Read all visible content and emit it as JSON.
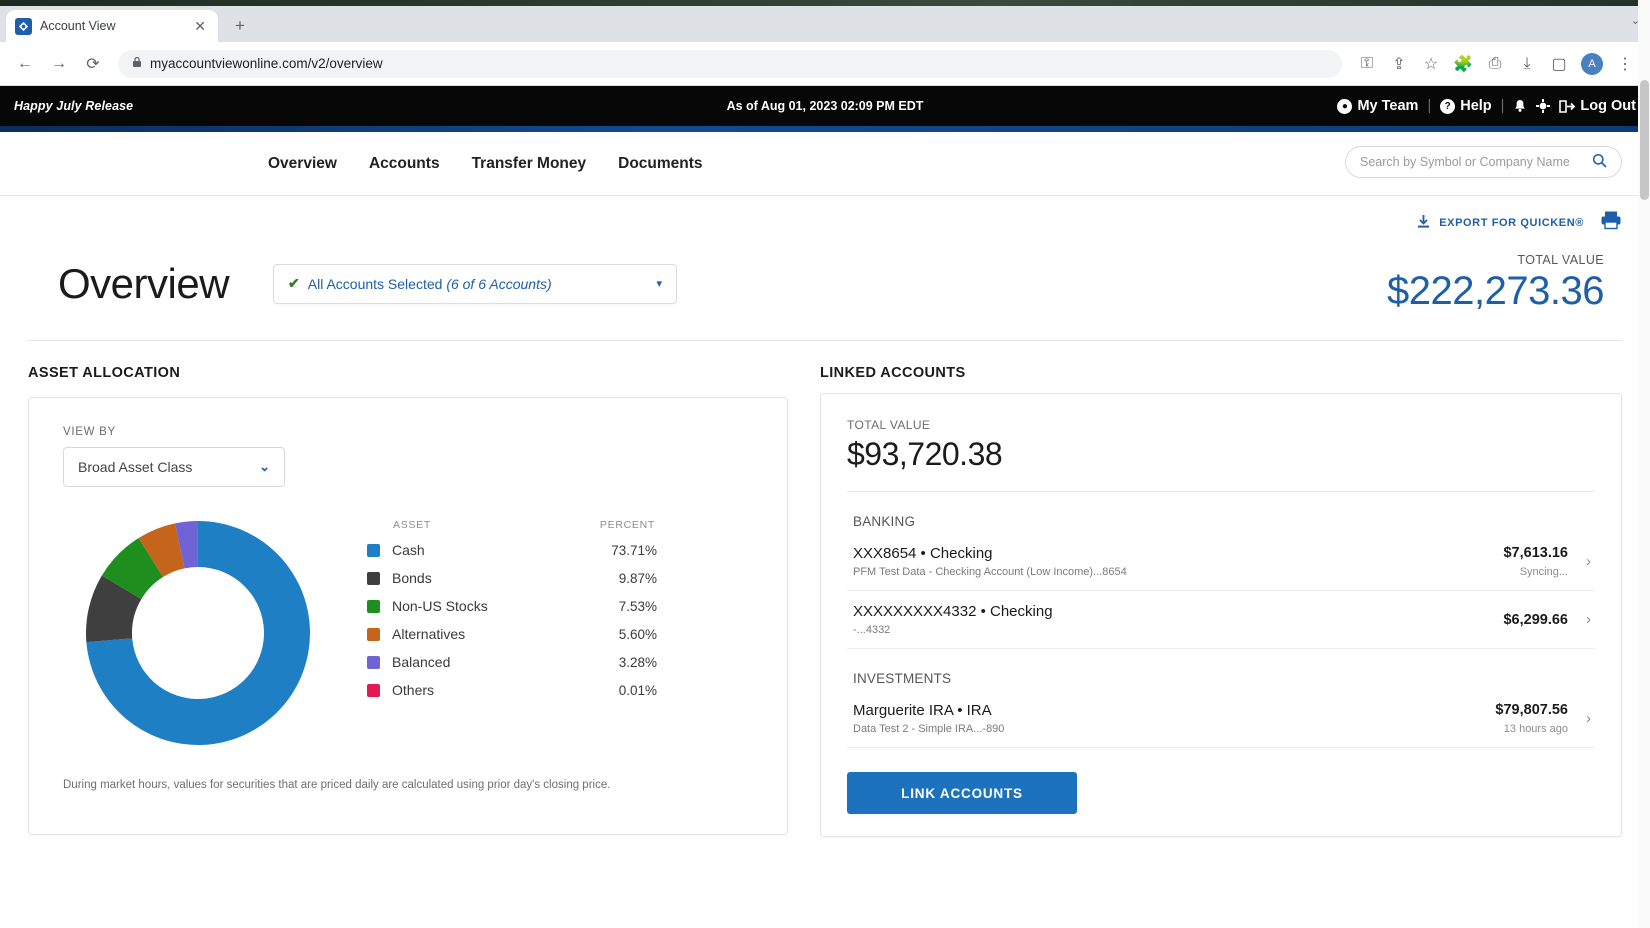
{
  "browser": {
    "tab_title": "Account View",
    "tab_close": "✕",
    "new_tab": "+",
    "window_caret": "⌄",
    "back": "←",
    "forward": "→",
    "reload": "⟳",
    "lock": "🔒",
    "url": "myaccountviewonline.com/v2/overview",
    "avatar_initial": "A",
    "toolbar_icons": [
      "key-icon",
      "share-icon",
      "star-icon",
      "extensions-icon",
      "cast-icon",
      "download-icon",
      "sidepanel-icon"
    ]
  },
  "appbar": {
    "release": "Happy July Release",
    "as_of": "As of Aug 01, 2023 02:09 PM EDT",
    "my_team": "My Team",
    "help": "Help",
    "log_out": "Log Out",
    "separator": "|"
  },
  "nav": {
    "links": [
      "Overview",
      "Accounts",
      "Transfer Money",
      "Documents"
    ],
    "search_placeholder": "Search by Symbol or Company Name",
    "search_value": ""
  },
  "utility": {
    "export_label": "EXPORT FOR QUICKEN®",
    "print_icon": "printer-icon"
  },
  "header": {
    "title": "Overview",
    "account_selector": "All Accounts Selected",
    "account_selector_detail": "(6 of 6 Accounts)",
    "total_label": "TOTAL VALUE",
    "total_value": "$222,273.36"
  },
  "asset_allocation": {
    "section_title": "ASSET ALLOCATION",
    "view_by_label": "VIEW BY",
    "view_by_value": "Broad Asset Class",
    "col_asset": "ASSET",
    "col_percent": "PERCENT",
    "disclaimer": "During market hours, values for securities that are priced daily are calculated using prior day's closing price."
  },
  "chart_data": {
    "type": "pie",
    "title": "Asset Allocation",
    "labels": [
      "Cash",
      "Bonds",
      "Non-US Stocks",
      "Alternatives",
      "Balanced",
      "Others"
    ],
    "values": [
      73.71,
      9.87,
      7.53,
      5.6,
      3.28,
      0.01
    ],
    "value_labels": [
      "73.71%",
      "9.87%",
      "7.53%",
      "5.60%",
      "3.28%",
      "0.01%"
    ],
    "colors": [
      "#1f7fc4",
      "#3f3f3f",
      "#1e8f1e",
      "#c4651b",
      "#6f63d6",
      "#e01b53"
    ],
    "donut": true,
    "legend_position": "right"
  },
  "linked_accounts": {
    "section_title": "LINKED ACCOUNTS",
    "total_label": "TOTAL VALUE",
    "total_value": "$93,720.38",
    "groups": [
      {
        "name": "BANKING",
        "rows": [
          {
            "name": "XXX8654 • Checking",
            "sub": "PFM Test Data - Checking Account (Low Income)...8654",
            "amount": "$7,613.16",
            "status": "Syncing...",
            "chevron": "›"
          },
          {
            "name": "XXXXXXXXX4332 • Checking",
            "sub": "-...4332",
            "amount": "$6,299.66",
            "status": "",
            "chevron": "›"
          }
        ]
      },
      {
        "name": "INVESTMENTS",
        "rows": [
          {
            "name": "Marguerite IRA • IRA",
            "sub": "Data Test 2 - Simple IRA...-890",
            "amount": "$79,807.56",
            "status": "13 hours ago",
            "chevron": "›"
          }
        ]
      }
    ],
    "link_button": "LINK ACCOUNTS"
  }
}
